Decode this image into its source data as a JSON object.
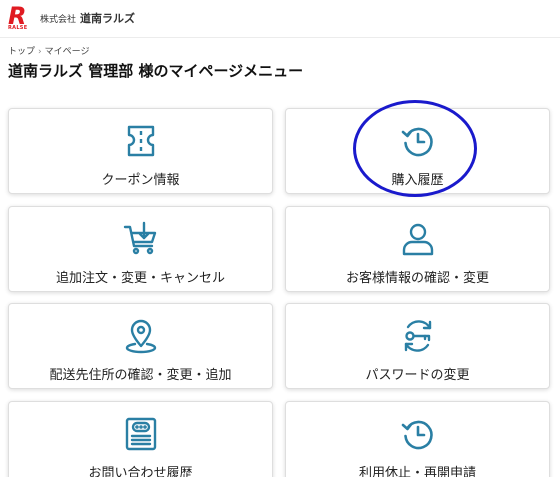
{
  "header": {
    "logo_mark": "R",
    "logo_sub": "RALSE",
    "company_prefix": "株式会社",
    "company_name": "道南ラルズ"
  },
  "breadcrumb": {
    "home": "トップ",
    "separator": "›",
    "current": "マイページ"
  },
  "page_title": "道南ラルズ 管理部 様のマイページメニュー",
  "menu": [
    {
      "label": "クーポン情報",
      "icon": "coupon-icon"
    },
    {
      "label": "購入履歴",
      "icon": "history-icon"
    },
    {
      "label": "追加注文・変更・キャンセル",
      "icon": "cart-icon"
    },
    {
      "label": "お客様情報の確認・変更",
      "icon": "user-icon"
    },
    {
      "label": "配送先住所の確認・変更・追加",
      "icon": "location-pin-icon"
    },
    {
      "label": "パスワードの変更",
      "icon": "key-icon"
    },
    {
      "label": "お問い合わせ履歴",
      "icon": "inquiry-icon"
    },
    {
      "label": "利用休止・再開申請",
      "icon": "history-icon"
    }
  ],
  "colors": {
    "icon": "#2a7fa4",
    "brand": "#e01b22",
    "highlight_circle": "#1a1acc"
  }
}
